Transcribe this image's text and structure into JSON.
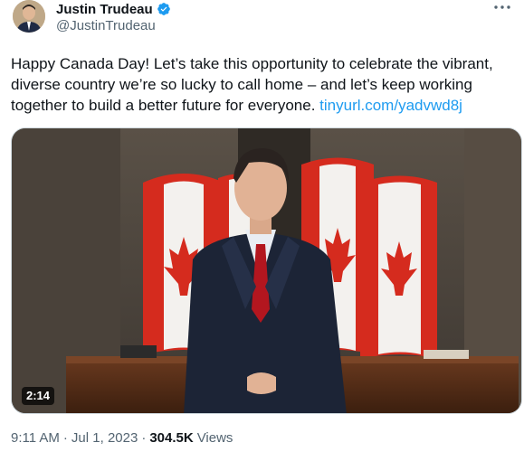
{
  "author": {
    "display_name": "Justin Trudeau",
    "handle": "@JustinTrudeau",
    "verified": true
  },
  "tweet": {
    "text_before_link": "Happy Canada Day! Let’s take this opportunity to celebrate the vibrant, diverse country we’re so lucky to call home – and let’s keep working together to build a better future for everyone. ",
    "link_text": "tinyurl.com/yadvwd8j"
  },
  "media": {
    "type": "video",
    "duration": "2:14"
  },
  "meta": {
    "time": "9:11 AM",
    "separator": "·",
    "date": "Jul 1, 2023",
    "views_count": "304.5K",
    "views_label": "Views"
  },
  "colors": {
    "link": "#1d9bf0",
    "verified": "#1d9bf0",
    "secondary_text": "#536471",
    "flag_red": "#d52b1e"
  },
  "icons": {
    "verified": "verified-badge-icon",
    "more": "more-options-icon"
  }
}
